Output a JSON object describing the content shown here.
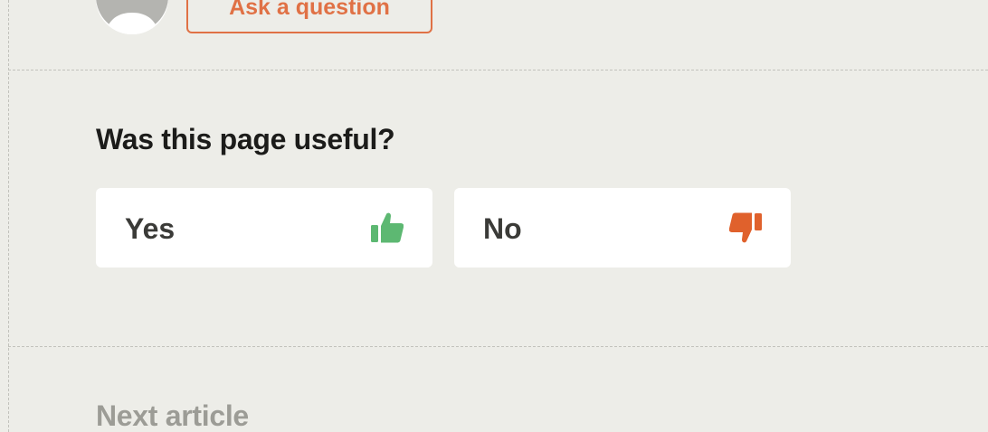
{
  "top": {
    "ask_button_label": "Ask a question"
  },
  "feedback": {
    "title": "Was this page useful?",
    "yes_label": "Yes",
    "no_label": "No",
    "yes_icon": "thumbs-up-icon",
    "no_icon": "thumbs-down-icon",
    "yes_color": "#5db872",
    "no_color": "#e0612c"
  },
  "next": {
    "heading": "Next article"
  }
}
